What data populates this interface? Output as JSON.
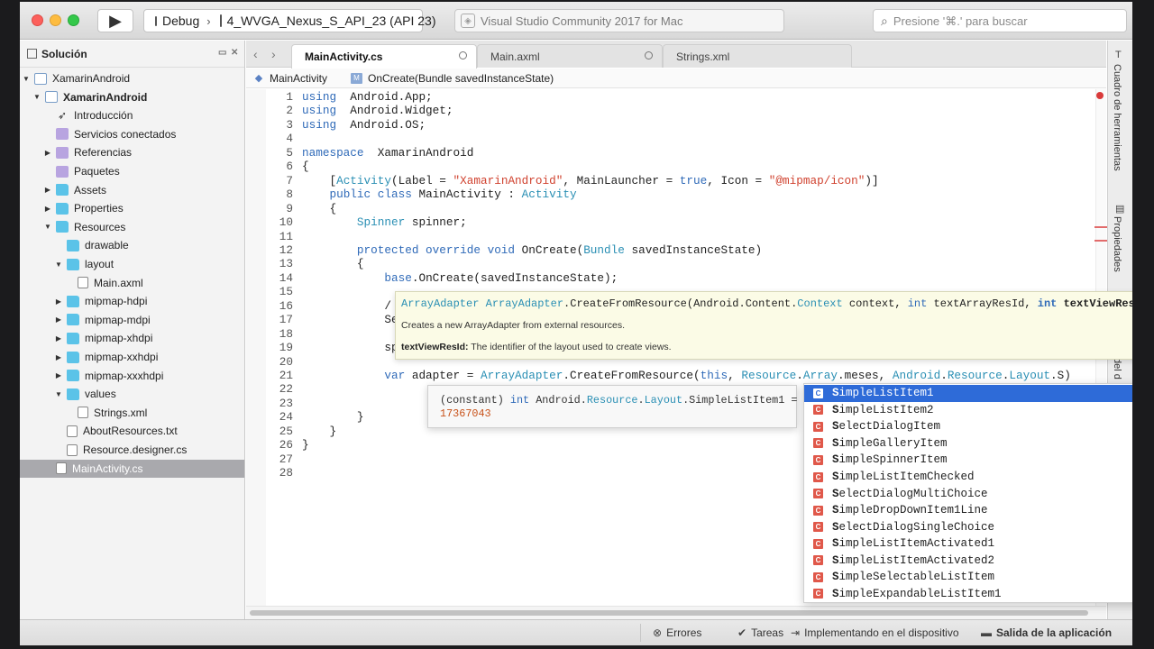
{
  "toolbar": {
    "config": "Debug",
    "device": "4_WVGA_Nexus_S_API_23 (API 23)",
    "status": "Visual Studio Community 2017 for Mac",
    "search_placeholder": "Presione '⌘.' para buscar"
  },
  "solution": {
    "title": "Solución",
    "items": [
      {
        "label": "XamarinAndroid",
        "depth": 0,
        "twisty": "open",
        "icon": "proj",
        "bold": false
      },
      {
        "label": "XamarinAndroid",
        "depth": 1,
        "twisty": "open",
        "icon": "proj",
        "bold": true
      },
      {
        "label": "Introducción",
        "depth": 2,
        "twisty": "",
        "icon": "rocket",
        "bold": false
      },
      {
        "label": "Servicios conectados",
        "depth": 2,
        "twisty": "",
        "icon": "lock",
        "bold": false
      },
      {
        "label": "Referencias",
        "depth": 2,
        "twisty": "closed",
        "icon": "lock",
        "bold": false
      },
      {
        "label": "Paquetes",
        "depth": 2,
        "twisty": "",
        "icon": "lock",
        "bold": false
      },
      {
        "label": "Assets",
        "depth": 2,
        "twisty": "closed",
        "icon": "folder",
        "bold": false
      },
      {
        "label": "Properties",
        "depth": 2,
        "twisty": "closed",
        "icon": "folder",
        "bold": false
      },
      {
        "label": "Resources",
        "depth": 2,
        "twisty": "open",
        "icon": "folder",
        "bold": false
      },
      {
        "label": "drawable",
        "depth": 3,
        "twisty": "",
        "icon": "folder",
        "bold": false
      },
      {
        "label": "layout",
        "depth": 3,
        "twisty": "open",
        "icon": "folder",
        "bold": false
      },
      {
        "label": "Main.axml",
        "depth": 4,
        "twisty": "",
        "icon": "file",
        "bold": false
      },
      {
        "label": "mipmap-hdpi",
        "depth": 3,
        "twisty": "closed",
        "icon": "folder",
        "bold": false
      },
      {
        "label": "mipmap-mdpi",
        "depth": 3,
        "twisty": "closed",
        "icon": "folder",
        "bold": false
      },
      {
        "label": "mipmap-xhdpi",
        "depth": 3,
        "twisty": "closed",
        "icon": "folder",
        "bold": false
      },
      {
        "label": "mipmap-xxhdpi",
        "depth": 3,
        "twisty": "closed",
        "icon": "folder",
        "bold": false
      },
      {
        "label": "mipmap-xxxhdpi",
        "depth": 3,
        "twisty": "closed",
        "icon": "folder",
        "bold": false
      },
      {
        "label": "values",
        "depth": 3,
        "twisty": "open",
        "icon": "folder",
        "bold": false
      },
      {
        "label": "Strings.xml",
        "depth": 4,
        "twisty": "",
        "icon": "file",
        "bold": false
      },
      {
        "label": "AboutResources.txt",
        "depth": 3,
        "twisty": "",
        "icon": "file",
        "bold": false
      },
      {
        "label": "Resource.designer.cs",
        "depth": 3,
        "twisty": "",
        "icon": "file",
        "bold": false
      },
      {
        "label": "MainActivity.cs",
        "depth": 2,
        "twisty": "",
        "icon": "file",
        "bold": false,
        "selected": true
      }
    ]
  },
  "tabs": [
    {
      "label": "MainActivity.cs",
      "active": true
    },
    {
      "label": "Main.axml",
      "active": false
    },
    {
      "label": "Strings.xml",
      "active": false
    }
  ],
  "breadcrumb": {
    "class": "MainActivity",
    "method": "OnCreate(Bundle savedInstanceState)"
  },
  "code": [
    {
      "n": "1",
      "t": [
        [
          "kw",
          "using"
        ],
        [
          "",
          "  Android.App;"
        ]
      ]
    },
    {
      "n": "2",
      "t": [
        [
          "kw",
          "using"
        ],
        [
          "",
          "  Android.Widget;"
        ]
      ]
    },
    {
      "n": "3",
      "t": [
        [
          "kw",
          "using"
        ],
        [
          "",
          "  Android.OS;"
        ]
      ]
    },
    {
      "n": "4",
      "t": []
    },
    {
      "n": "5",
      "t": [
        [
          "kw",
          "namespace"
        ],
        [
          "",
          "  XamarinAndroid"
        ]
      ]
    },
    {
      "n": "6",
      "t": [
        [
          "",
          "{"
        ]
      ]
    },
    {
      "n": "7",
      "t": [
        [
          "",
          "    ["
        ],
        [
          "ty",
          "Activity"
        ],
        [
          "",
          "(Label = "
        ],
        [
          "st",
          "\"XamarinAndroid\""
        ],
        [
          "",
          ", MainLauncher = "
        ],
        [
          "kw",
          "true"
        ],
        [
          "",
          ", Icon = "
        ],
        [
          "st",
          "\"@mipmap/icon\""
        ],
        [
          "",
          ")]"
        ]
      ]
    },
    {
      "n": "8",
      "t": [
        [
          "",
          "    "
        ],
        [
          "kw",
          "public class"
        ],
        [
          "",
          " MainActivity : "
        ],
        [
          "ty",
          "Activity"
        ]
      ]
    },
    {
      "n": "9",
      "t": [
        [
          "",
          "    {"
        ]
      ]
    },
    {
      "n": "10",
      "t": [
        [
          "",
          "        "
        ],
        [
          "ty",
          "Spinner"
        ],
        [
          "",
          " spinner;"
        ]
      ]
    },
    {
      "n": "11",
      "t": []
    },
    {
      "n": "12",
      "t": [
        [
          "",
          "        "
        ],
        [
          "kw",
          "protected override void"
        ],
        [
          "",
          " OnCreate("
        ],
        [
          "ty",
          "Bundle"
        ],
        [
          "",
          " savedInstanceState)"
        ]
      ]
    },
    {
      "n": "13",
      "t": [
        [
          "",
          "        {"
        ]
      ]
    },
    {
      "n": "14",
      "t": [
        [
          "",
          "            "
        ],
        [
          "kw",
          "base"
        ],
        [
          "",
          ".OnCreate(savedInstanceState);"
        ]
      ]
    },
    {
      "n": "15",
      "t": []
    },
    {
      "n": "16",
      "t": [
        [
          "",
          "            /"
        ]
      ]
    },
    {
      "n": "17",
      "t": [
        [
          "",
          "            Se"
        ]
      ]
    },
    {
      "n": "18",
      "t": []
    },
    {
      "n": "19",
      "t": [
        [
          "",
          "            sp"
        ]
      ]
    },
    {
      "n": "20",
      "t": []
    },
    {
      "n": "21",
      "t": [
        [
          "",
          "            "
        ],
        [
          "kw",
          "var"
        ],
        [
          "",
          " adapter = "
        ],
        [
          "ty",
          "ArrayAdapter"
        ],
        [
          "",
          ".CreateFromResource("
        ],
        [
          "kw",
          "this"
        ],
        [
          "",
          ", "
        ],
        [
          "ty",
          "Resource"
        ],
        [
          "",
          "."
        ],
        [
          "ty",
          "Array"
        ],
        [
          "",
          ".meses, "
        ],
        [
          "ty",
          "Android"
        ],
        [
          "",
          "."
        ],
        [
          "ty",
          "Resource"
        ],
        [
          "",
          "."
        ],
        [
          "ty",
          "Layout"
        ],
        [
          "",
          ".S)"
        ]
      ]
    },
    {
      "n": "22",
      "t": []
    },
    {
      "n": "23",
      "t": []
    },
    {
      "n": "24",
      "t": [
        [
          "",
          "        }"
        ]
      ]
    },
    {
      "n": "25",
      "t": [
        [
          "",
          "    }"
        ]
      ]
    },
    {
      "n": "26",
      "t": [
        [
          "",
          "}"
        ]
      ]
    },
    {
      "n": "27",
      "t": []
    },
    {
      "n": "28",
      "t": []
    }
  ],
  "signature": {
    "ret": "ArrayAdapter",
    "cls": "ArrayAdapter",
    "method": ".CreateFromResource(",
    "ns": "Android.Content.",
    "ctx_type": "Context",
    "p1": " context, ",
    "int1": "int",
    "p2": " textArrayResId, ",
    "int2": "int",
    "p3": "textViewResId",
    "close": ")",
    "desc": "Creates a new ArrayAdapter from external resources.",
    "param_name": "textViewResId:",
    "param_desc": " The identifier of the layout used to create views."
  },
  "constant_tip": {
    "prefix": "(constant) ",
    "type": "int",
    "ns1": " Android.",
    "c1": "Resource",
    "dot1": ".",
    "c2": "Layout",
    "rest": ".SimpleListItem1 =",
    "value": "17367043"
  },
  "completion": [
    {
      "first": "S",
      "rest": "impleListItem1",
      "selected": true
    },
    {
      "first": "S",
      "rest": "impleListItem2"
    },
    {
      "first": "S",
      "rest": "electDialogItem"
    },
    {
      "first": "S",
      "rest": "impleGalleryItem"
    },
    {
      "first": "S",
      "rest": "impleSpinnerItem"
    },
    {
      "first": "S",
      "rest": "impleListItemChecked"
    },
    {
      "first": "S",
      "rest": "electDialogMultiChoice"
    },
    {
      "first": "S",
      "rest": "impleDropDownItem1Line"
    },
    {
      "first": "S",
      "rest": "electDialogSingleChoice"
    },
    {
      "first": "S",
      "rest": "impleListItemActivated1"
    },
    {
      "first": "S",
      "rest": "impleListItemActivated2"
    },
    {
      "first": "S",
      "rest": "impleSelectableListItem"
    },
    {
      "first": "S",
      "rest": "impleExpandableListItem1"
    }
  ],
  "completion_badge": "C",
  "right_pads": {
    "toolbox": "Cuadro de herramientas",
    "properties": "Propiedades",
    "partial": "del d"
  },
  "statusbar": {
    "errors": "Errores",
    "tasks": "Tareas",
    "deploy": "Implementando en el dispositivo",
    "output": "Salida de la aplicación"
  }
}
